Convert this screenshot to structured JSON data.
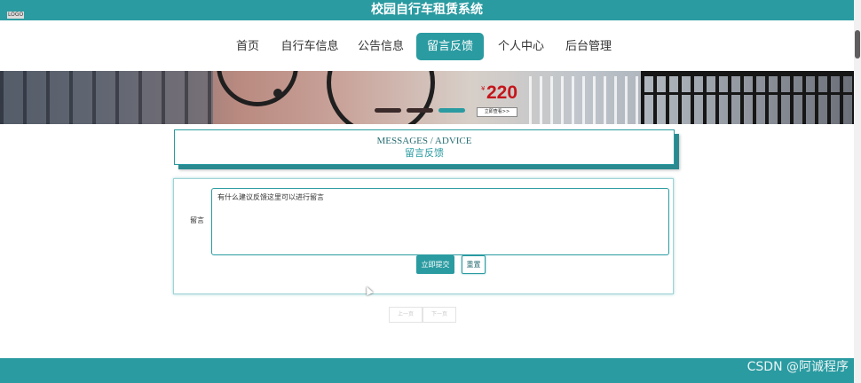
{
  "app": {
    "title": "校园自行车租赁系统",
    "logo_text": "LOGO"
  },
  "nav": {
    "items": [
      {
        "label": "首页",
        "active": false
      },
      {
        "label": "自行车信息",
        "active": false
      },
      {
        "label": "公告信息",
        "active": false
      },
      {
        "label": "留言反馈",
        "active": true
      },
      {
        "label": "个人中心",
        "active": false
      },
      {
        "label": "后台管理",
        "active": false
      }
    ]
  },
  "banner": {
    "currency": "¥",
    "price": "220",
    "button_label": "立即查看>>",
    "slide_count": 3,
    "active_slide": 2
  },
  "section": {
    "title_en": "MESSAGES / ADVICE",
    "title_cn": "留言反馈"
  },
  "form": {
    "label": "留言",
    "placeholder": "有什么建议反馈这里可以进行留言",
    "submit_label": "立即提交",
    "reset_label": "重置"
  },
  "pagination": {
    "prev_label": "上一页",
    "next_label": "下一页"
  },
  "watermark": "CSDN @阿诚程序",
  "colors": {
    "accent": "#2a9ba1",
    "price_red": "#c4161c"
  }
}
